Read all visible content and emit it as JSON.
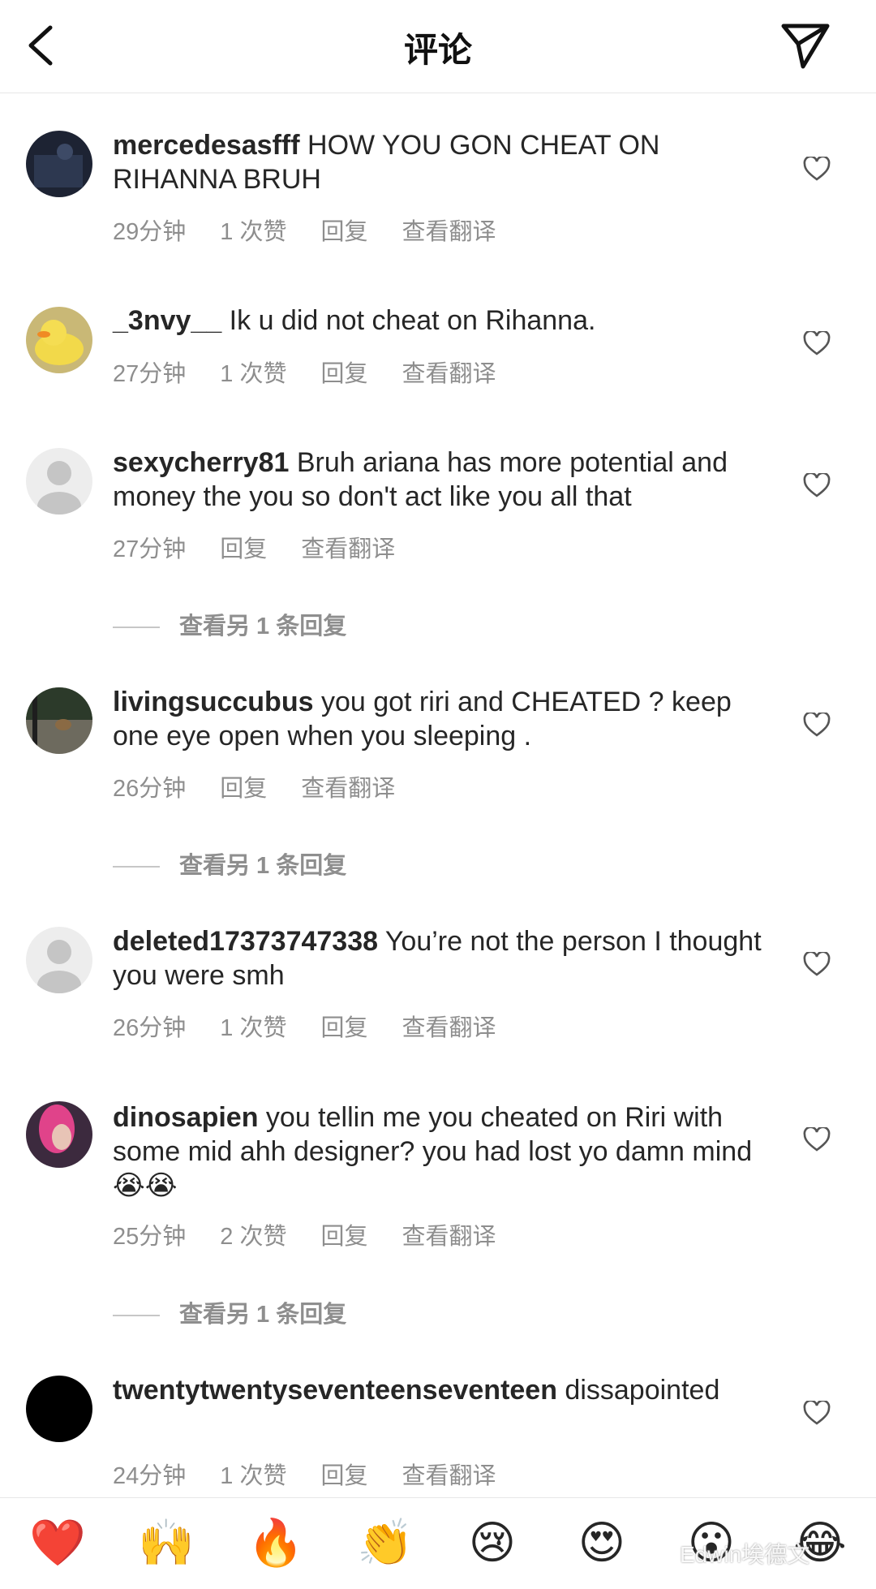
{
  "header": {
    "title": "评论",
    "back_icon": "chevron-left-icon",
    "send_icon": "paper-plane-icon"
  },
  "comments": [
    {
      "username": "mercedesasfff",
      "text": " HOW YOU GON CHEAT ON RIHANNA BRUH",
      "time": "29分钟",
      "likes": "1 次赞",
      "reply": "回复",
      "translate": "查看翻译"
    },
    {
      "username": "_3nvy__",
      "text": " Ik u did not cheat on Rihanna.",
      "time": "27分钟",
      "likes": "1 次赞",
      "reply": "回复",
      "translate": "查看翻译"
    },
    {
      "username": "sexycherry81",
      "text": " Bruh ariana has more potential and money the you so don't act like you all that",
      "time": "27分钟",
      "likes": "",
      "reply": "回复",
      "translate": "查看翻译"
    },
    {
      "username": "livingsuccubus",
      "text": " you got riri and CHEATED ? keep one eye open when you sleeping .",
      "time": "26分钟",
      "likes": "",
      "reply": "回复",
      "translate": "查看翻译"
    },
    {
      "username": "deleted17373747338",
      "text": " You’re not the person I thought you were smh",
      "time": "26分钟",
      "likes": "1 次赞",
      "reply": "回复",
      "translate": "查看翻译"
    },
    {
      "username": "dinosapien",
      "text": " you tellin me you cheated on Riri with some mid ahh designer? you had lost yo damn mind 😭😭",
      "time": "25分钟",
      "likes": "2 次赞",
      "reply": "回复",
      "translate": "查看翻译"
    },
    {
      "username": "twentytwentyseventeenseventeen",
      "text": " dissapointed",
      "time": "24分钟",
      "likes": "1 次赞",
      "reply": "回复",
      "translate": "查看翻译"
    }
  ],
  "view_more_replies": [
    "查看另 1 条回复",
    "查看另 1 条回复",
    "查看另 1 条回复"
  ],
  "emoji_bar": [
    "❤️",
    "🙌",
    "🔥",
    "👏",
    "😢",
    "😍",
    "😮",
    "😂"
  ],
  "watermark": "Edwin埃德文",
  "colors": {
    "text": "#262626",
    "meta": "#8e8e8e",
    "divider": "#e6e6e6"
  }
}
